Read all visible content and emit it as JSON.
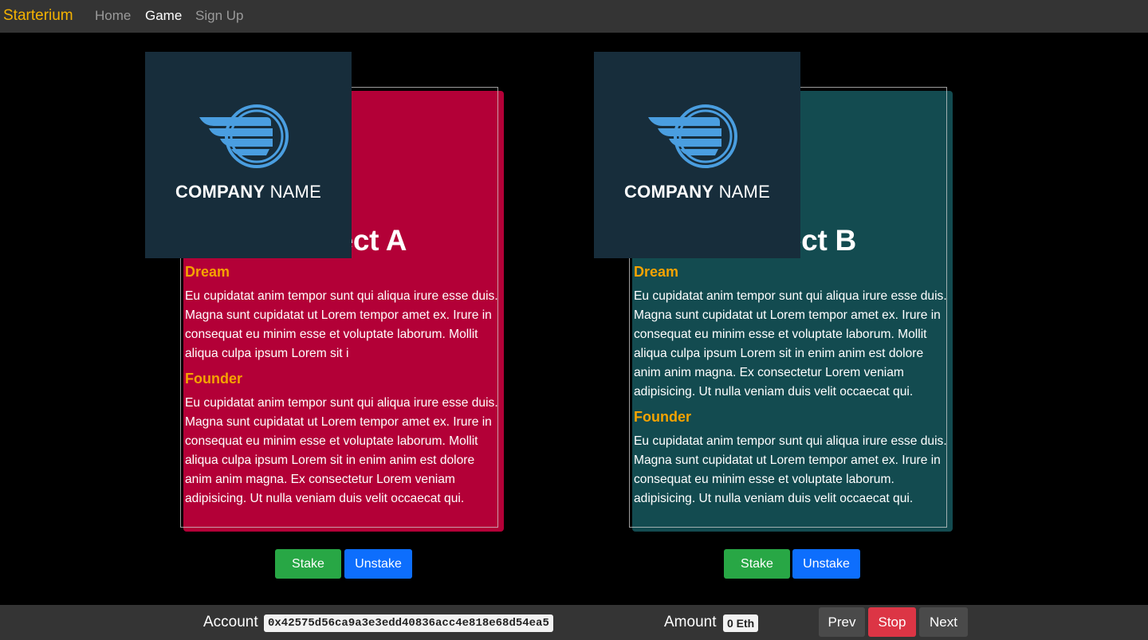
{
  "navbar": {
    "brand": "Starterium",
    "links": [
      "Home",
      "Game",
      "Sign Up"
    ],
    "active": "Game"
  },
  "projects": [
    {
      "title": "Project A",
      "color": "#b30037",
      "logo": {
        "bold": "COMPANY",
        "thin": "NAME"
      },
      "dream_heading": "Dream",
      "dream_text": "Eu cupidatat anim tempor sunt qui aliqua irure esse duis. Magna sunt cupidatat ut Lorem tempor amet ex. Irure in consequat eu minim esse et voluptate laborum. Mollit aliqua culpa ipsum Lorem sit i",
      "founder_heading": "Founder",
      "founder_text": "Eu cupidatat anim tempor sunt qui aliqua irure esse duis. Magna sunt cupidatat ut Lorem tempor amet ex. Irure in consequat eu minim esse et voluptate laborum. Mollit aliqua culpa ipsum Lorem sit in enim anim est dolore anim anim magna. Ex consectetur Lorem veniam adipisicing. Ut nulla veniam duis velit occaecat qui.",
      "stake_label": "Stake",
      "unstake_label": "Unstake"
    },
    {
      "title": "Project B",
      "color": "#134b50",
      "logo": {
        "bold": "COMPANY",
        "thin": "NAME"
      },
      "dream_heading": "Dream",
      "dream_text": "Eu cupidatat anim tempor sunt qui aliqua irure esse duis. Magna sunt cupidatat ut Lorem tempor amet ex. Irure in consequat eu minim esse et voluptate laborum. Mollit aliqua culpa ipsum Lorem sit in enim anim est dolore anim anim magna. Ex consectetur Lorem veniam adipisicing. Ut nulla veniam duis velit occaecat qui.",
      "founder_heading": "Founder",
      "founder_text": "Eu cupidatat anim tempor sunt qui aliqua irure esse duis. Magna sunt cupidatat ut Lorem tempor amet ex. Irure in consequat eu minim esse et voluptate laborum. adipisicing. Ut nulla veniam duis velit occaecat qui.",
      "stake_label": "Stake",
      "unstake_label": "Unstake"
    }
  ],
  "footer": {
    "account_label": "Account",
    "account_value": "0x42575d56ca9a3e3edd40836acc4e818e68d54ea5",
    "amount_label": "Amount",
    "amount_value": "0 Eth",
    "prev_label": "Prev",
    "stop_label": "Stop",
    "next_label": "Next"
  },
  "colors": {
    "brand": "#f5b301",
    "section_heading": "#f5a300",
    "stake": "#28a745",
    "unstake": "#0d6efd",
    "stop": "#dc3545"
  }
}
